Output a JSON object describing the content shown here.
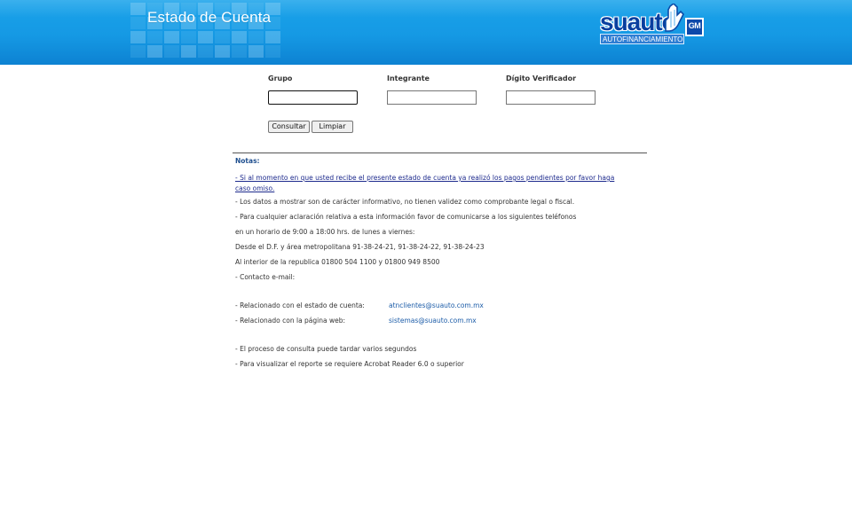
{
  "header": {
    "title": "Estado de Cuenta",
    "brand_name": "suauto",
    "brand_subtitle": "AUTOFINANCIAMIENTO",
    "gm_logo": "GM",
    "colors": {
      "header_top": "#1aa3ea",
      "header_bottom": "#0d82d2",
      "brand_blue": "#083f9f"
    }
  },
  "form": {
    "group": {
      "label": "Grupo",
      "value": "",
      "placeholder": ""
    },
    "member": {
      "label": "Integrante",
      "value": "",
      "placeholder": ""
    },
    "check_digit": {
      "label": "Dígito Verificador",
      "value": "",
      "placeholder": ""
    },
    "buttons": {
      "consult": "Consultar",
      "clear": "Limpiar"
    }
  },
  "notes": {
    "title": "Notas:",
    "payment_notice": "- Si al momento en que usted recibe el presente estado de cuenta ya realizó los pagos pendientes por favor haga caso omiso.",
    "info_disclaimer": "- Los datos a mostrar son de carácter informativo, no tienen validez como comprobante legal o fiscal.",
    "contact_intro": "- Para cualquier aclaración relativa a esta información favor de comunicarse a los siguientes teléfonos",
    "hours": "en un horario de 9:00 a 18:00 hrs. de lunes a viernes:",
    "df_phones": "Desde el D.F. y área metropolitana 91-38-24-21, 91-38-24-22, 91-38-24-23",
    "interior_phones": "Al interior de la republica 01800 504 1100 y 01800 949 8500",
    "email_contact": "- Contacto e-mail:",
    "account_statement_label": "- Relacionado con el estado de cuenta:",
    "account_statement_email": "atnclientes@suauto.com.mx",
    "website_label": "- Relacionado con la página web:",
    "website_email": "sistemas@suauto.com.mx",
    "process_delay": "- El proceso de consulta puede tardar varios segundos",
    "acrobat_required": "- Para visualizar el reporte se requiere Acrobat Reader 6.0 o superior"
  }
}
